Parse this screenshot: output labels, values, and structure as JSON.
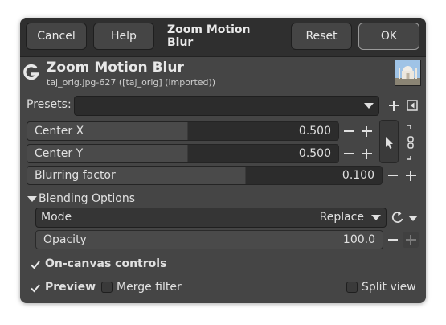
{
  "header": {
    "cancel_label": "Cancel",
    "help_label": "Help",
    "title": "Zoom Motion Blur",
    "reset_label": "Reset",
    "ok_label": "OK"
  },
  "filter": {
    "title": "Zoom Motion Blur",
    "subtitle": "taj_orig.jpg-627 ([taj_orig] (imported))"
  },
  "presets": {
    "label": "Presets:",
    "value": ""
  },
  "params": {
    "center_x": {
      "label": "Center X",
      "value": "0.500"
    },
    "center_y": {
      "label": "Center Y",
      "value": "0.500"
    },
    "blurring_factor": {
      "label": "Blurring factor",
      "value": "0.100"
    }
  },
  "blending": {
    "section_label": "Blending Options",
    "mode_label": "Mode",
    "mode_value": "Replace",
    "opacity_label": "Opacity",
    "opacity_value": "100.0"
  },
  "options": {
    "on_canvas_label": "On-canvas controls",
    "preview_label": "Preview",
    "merge_filter_label": "Merge filter",
    "split_view_label": "Split view"
  }
}
